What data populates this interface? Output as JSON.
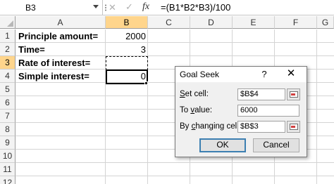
{
  "formula_bar": {
    "name_box": "B3",
    "fx_label": "fx",
    "formula": "=(B1*B2*B3)/100"
  },
  "columns": [
    "A",
    "B",
    "C",
    "D",
    "E",
    "F",
    "G"
  ],
  "rows": [
    "1",
    "2",
    "3",
    "4",
    "5",
    "6",
    "7",
    "8",
    "9",
    "10",
    "11",
    "12",
    "13"
  ],
  "cells": {
    "A1": "Principle amount=",
    "B1": "2000",
    "A2": "Time=",
    "B2": "3",
    "A3": "Rate of interest=",
    "A4": "Simple interest=",
    "B4": "0"
  },
  "dialog": {
    "title": "Goal Seek",
    "help_label": "?",
    "close_label": "✕",
    "set_cell_label_first": "S",
    "set_cell_label_rest": "et cell:",
    "set_cell_value": "$B$4",
    "to_value_label_first": "To ",
    "to_value_label_under": "v",
    "to_value_label_rest": "alue:",
    "to_value_value": "6000",
    "changing_cell_label_first": "By ",
    "changing_cell_label_under": "c",
    "changing_cell_label_rest": "hanging cell:",
    "changing_cell_value": "$B$3",
    "ok_label": "OK",
    "cancel_label": "Cancel"
  },
  "icons": {
    "cancel": "cancel-x-icon",
    "enter": "checkmark-icon",
    "range_selector": "range-selector-icon"
  },
  "colors": {
    "active_header": "#ffd58c",
    "default_button_border": "#3c7fb1"
  }
}
